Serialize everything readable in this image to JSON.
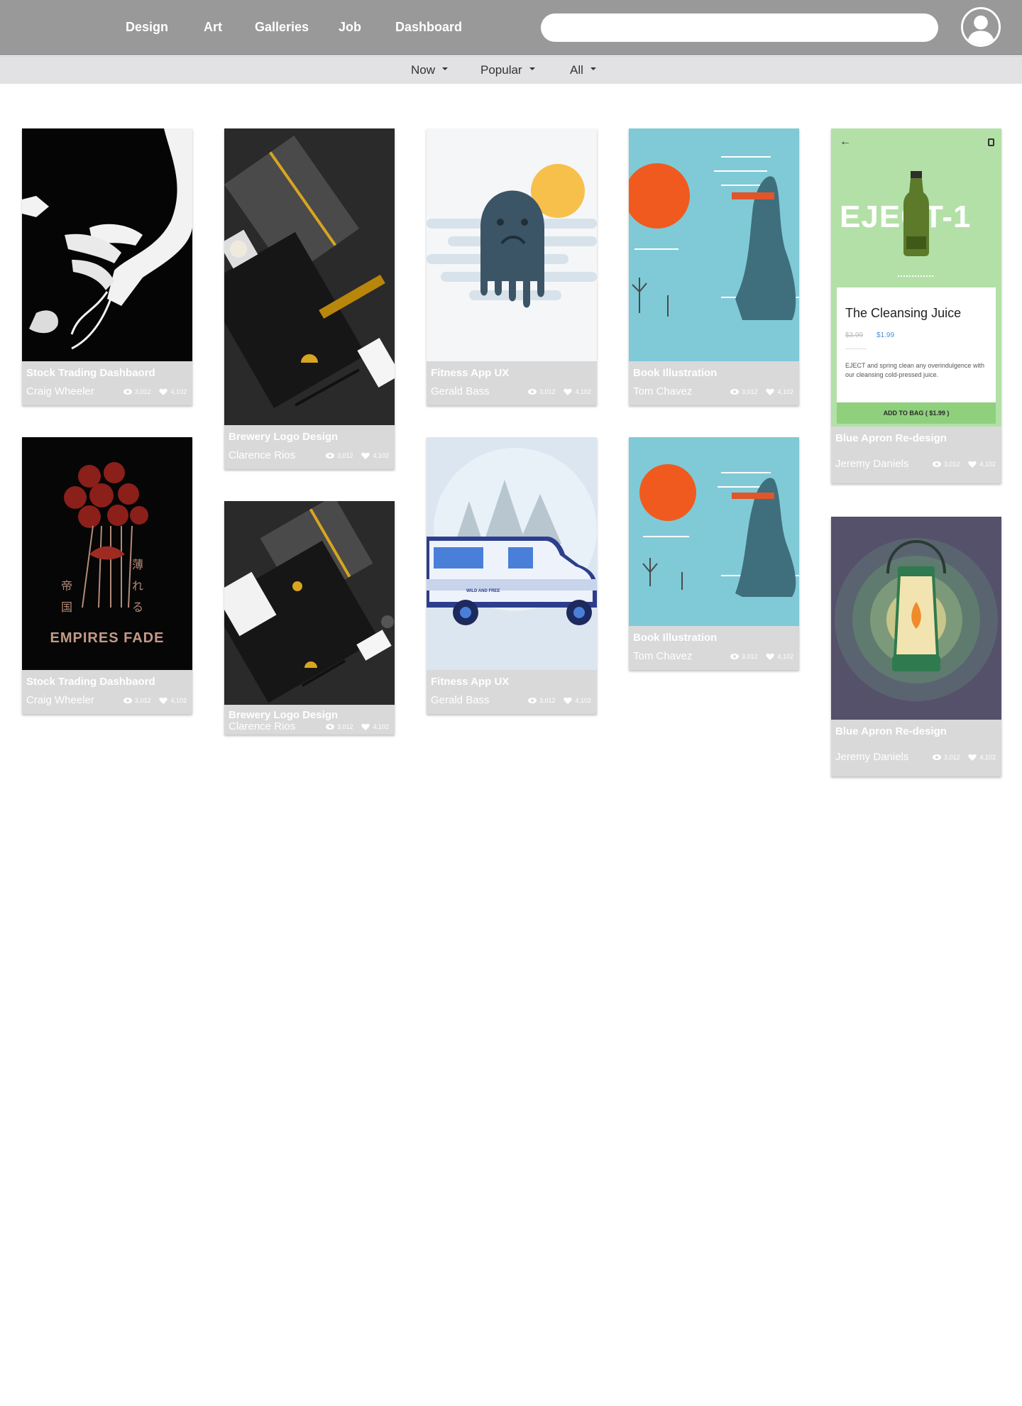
{
  "nav": {
    "links": [
      "Design",
      "Art",
      "Galleries",
      "Job",
      "Dashboard"
    ],
    "search_placeholder": ""
  },
  "filters": [
    "Now",
    "Popular",
    "All"
  ],
  "cards": [
    {
      "title": "Stock Trading Dashbaord",
      "author": "Craig Wheeler",
      "views": "3,012",
      "likes": "4,102"
    },
    {
      "title": "Brewery Logo Design",
      "author": "Clarence Rios",
      "views": "3,012",
      "likes": "4,102"
    },
    {
      "title": "Fitness App UX",
      "author": "Gerald Bass",
      "views": "3,012",
      "likes": "4,102"
    },
    {
      "title": "Book Illustration",
      "author": "Tom Chavez",
      "views": "3,012",
      "likes": "4,102"
    },
    {
      "title": "Blue Apron Re-design",
      "author": "Jeremy Daniels",
      "views": "3,012",
      "likes": "4,102"
    },
    {
      "title": "Stock Trading Dashbaord",
      "author": "Craig Wheeler",
      "views": "3,012",
      "likes": "4,102"
    },
    {
      "title": "Brewery Logo Design",
      "author": "Clarence Rios",
      "views": "3,012",
      "likes": "4,102"
    },
    {
      "title": "Fitness App UX",
      "author": "Gerald Bass",
      "views": "3,012",
      "likes": "4,102"
    },
    {
      "title": "Book Illustration",
      "author": "Tom Chavez",
      "views": "3,012",
      "likes": "4,102"
    },
    {
      "title": "Blue Apron Re-design",
      "author": "Jeremy Daniels",
      "views": "3,012",
      "likes": "4,102"
    }
  ],
  "artwork_text": {
    "juice_brand": "EJECT-1",
    "juice_name": "The Cleansing Juice",
    "juice_old_price": "$3.99",
    "juice_price": "$1.99",
    "juice_desc": "EJECT and spring clean any overindulgence with our cleansing cold-pressed juice.",
    "juice_cta": "ADD TO BAG ( $1.99 )",
    "empires": "EMPIRES FADE",
    "van_label": "WILD AND FREE"
  },
  "colors": {
    "topbar": "#999999",
    "filterbar": "#e2e2e4",
    "card_meta": "#d9d9d9",
    "accent_blue": "#4a90d9"
  }
}
